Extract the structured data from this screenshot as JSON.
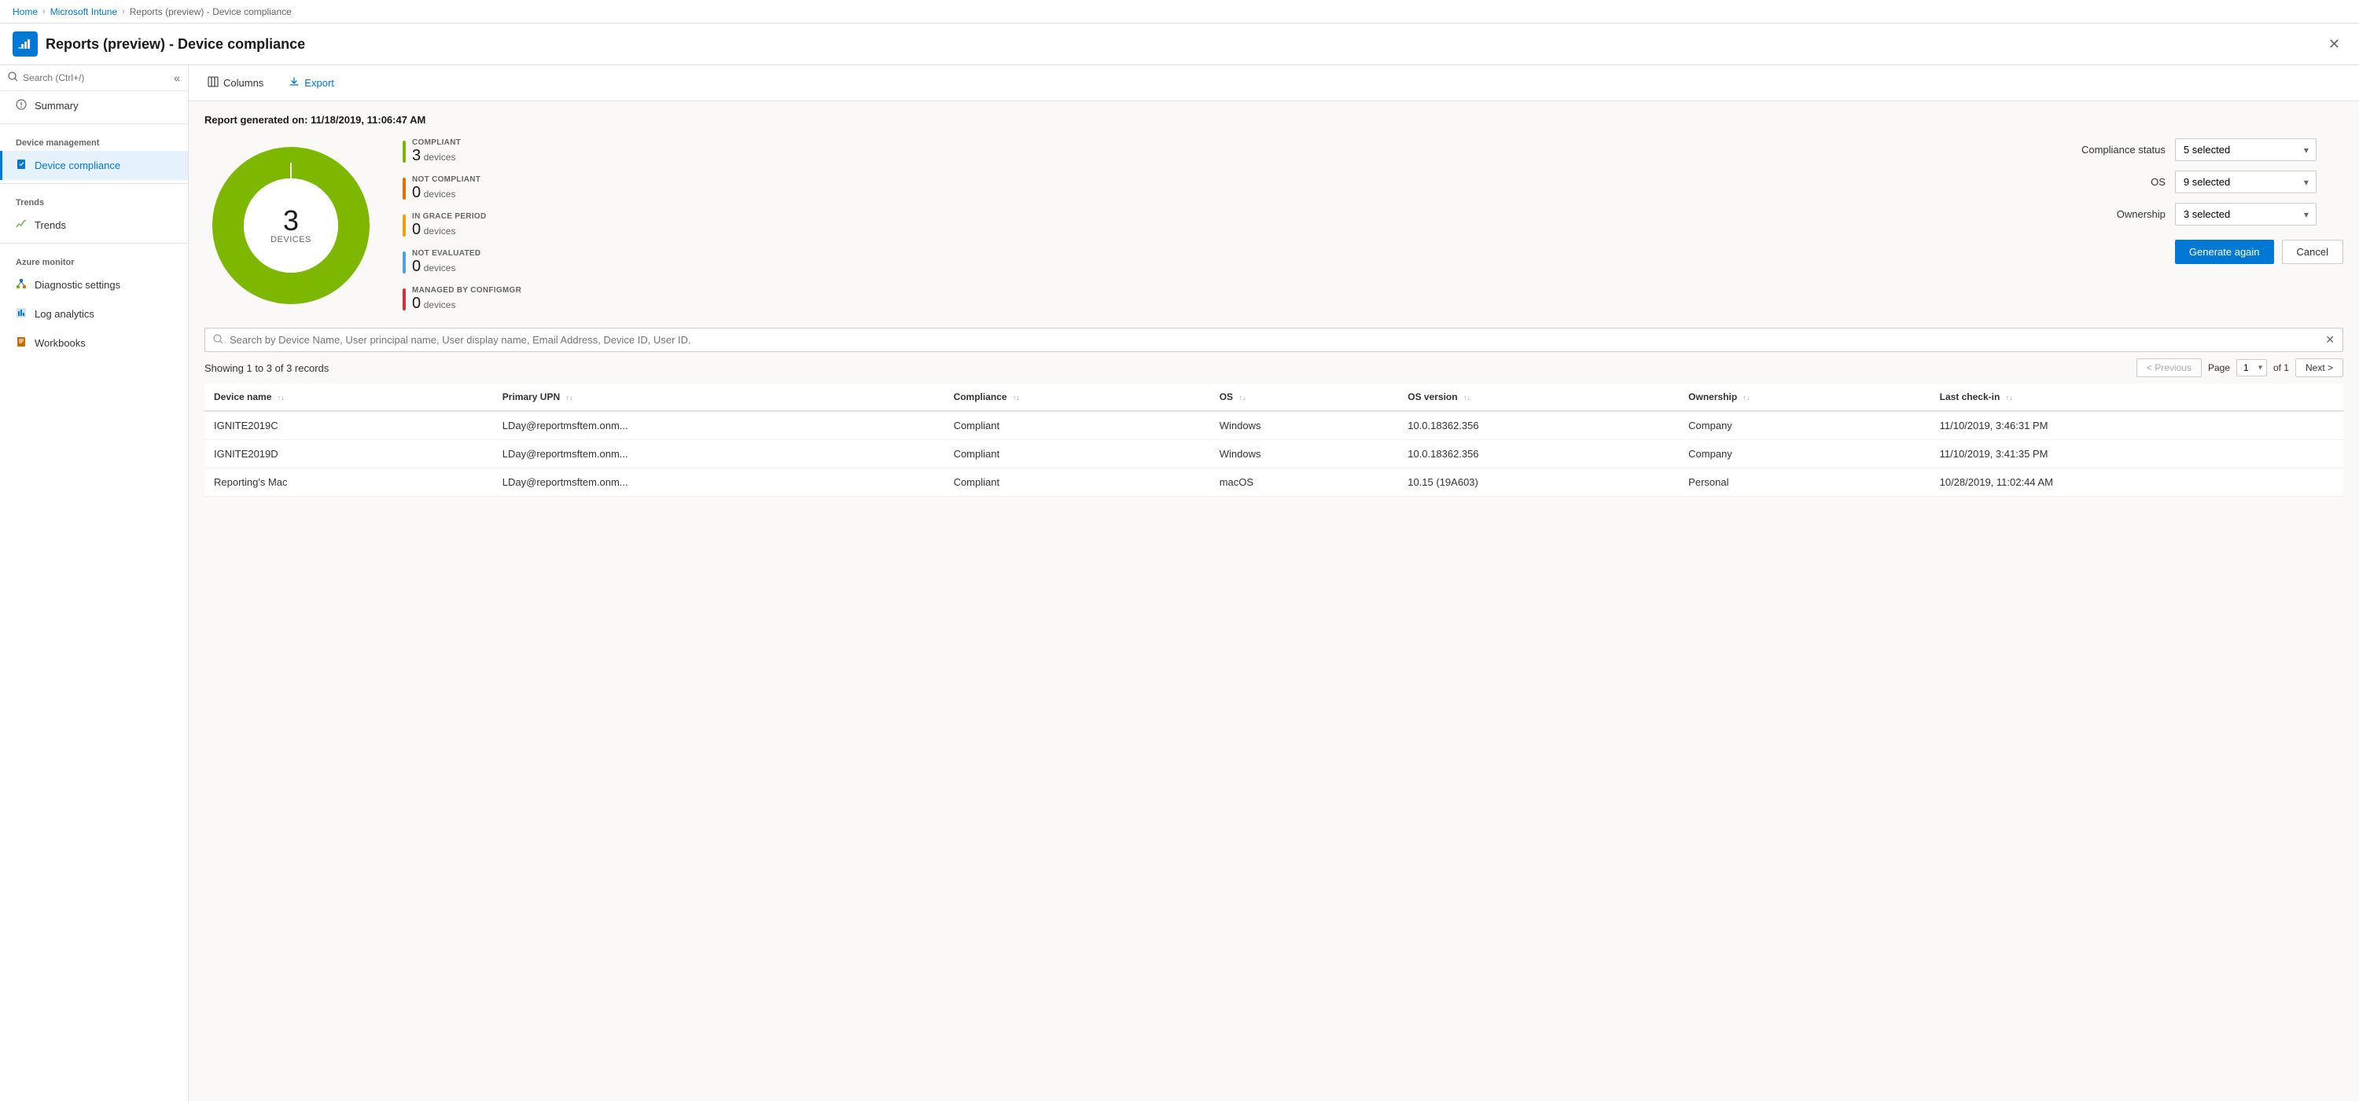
{
  "breadcrumb": {
    "items": [
      "Home",
      "Microsoft Intune",
      "Reports (preview) - Device compliance"
    ],
    "links": [
      "Home",
      "Microsoft Intune"
    ]
  },
  "title": "Reports (preview) - Device compliance",
  "title_icon": "📊",
  "toolbar": {
    "columns_label": "Columns",
    "export_label": "Export"
  },
  "report": {
    "generated_label": "Report generated on: 11/18/2019, 11:06:47 AM"
  },
  "chart": {
    "total": "3",
    "total_label": "DEVICES",
    "segments": [
      {
        "label": "COMPLIANT",
        "count": "3",
        "unit": "devices",
        "color": "#7DB700",
        "percent": 100
      },
      {
        "label": "NOT COMPLIANT",
        "count": "0",
        "unit": "devices",
        "color": "#E07000"
      },
      {
        "label": "IN GRACE PERIOD",
        "count": "0",
        "unit": "devices",
        "color": "#F0A000"
      },
      {
        "label": "NOT EVALUATED",
        "count": "0",
        "unit": "devices",
        "color": "#4CA3DD"
      },
      {
        "label": "MANAGED BY CONFIGMGR",
        "count": "0",
        "unit": "devices",
        "color": "#D13438"
      }
    ]
  },
  "filters": {
    "compliance_status_label": "Compliance status",
    "compliance_status_value": "5 selected",
    "os_label": "OS",
    "os_value": "9 selected",
    "ownership_label": "Ownership",
    "ownership_value": "3 selected",
    "generate_again_label": "Generate again",
    "cancel_label": "Cancel"
  },
  "search": {
    "placeholder": "Search by Device Name, User principal name, User display name, Email Address, Device ID, User ID."
  },
  "table": {
    "records_label": "Showing 1 to 3 of 3 records",
    "columns": [
      {
        "key": "device_name",
        "label": "Device name",
        "sortable": true
      },
      {
        "key": "primary_upn",
        "label": "Primary UPN",
        "sortable": true
      },
      {
        "key": "compliance",
        "label": "Compliance",
        "sortable": true
      },
      {
        "key": "os",
        "label": "OS",
        "sortable": true
      },
      {
        "key": "os_version",
        "label": "OS version",
        "sortable": true
      },
      {
        "key": "ownership",
        "label": "Ownership",
        "sortable": true
      },
      {
        "key": "last_checkin",
        "label": "Last check-in",
        "sortable": true
      }
    ],
    "rows": [
      {
        "device_name": "IGNITE2019C",
        "primary_upn": "LDay@reportmsftem.onm...",
        "compliance": "Compliant",
        "os": "Windows",
        "os_version": "10.0.18362.356",
        "ownership": "Company",
        "last_checkin": "11/10/2019, 3:46:31 PM"
      },
      {
        "device_name": "IGNITE2019D",
        "primary_upn": "LDay@reportmsftem.onm...",
        "compliance": "Compliant",
        "os": "Windows",
        "os_version": "10.0.18362.356",
        "ownership": "Company",
        "last_checkin": "11/10/2019, 3:41:35 PM"
      },
      {
        "device_name": "Reporting's Mac",
        "primary_upn": "LDay@reportmsftem.onm...",
        "compliance": "Compliant",
        "os": "macOS",
        "os_version": "10.15 (19A603)",
        "ownership": "Personal",
        "last_checkin": "10/28/2019, 11:02:44 AM"
      }
    ]
  },
  "pagination": {
    "previous_label": "< Previous",
    "next_label": "Next >",
    "page_label": "Page",
    "of_label": "of 1",
    "current_page": "1"
  },
  "sidebar": {
    "search_placeholder": "Search (Ctrl+/)",
    "collapse_icon": "«",
    "sections": [
      {
        "items": [
          {
            "id": "summary",
            "label": "Summary",
            "icon": "ℹ",
            "active": false
          }
        ]
      },
      {
        "section_label": "Device management",
        "items": [
          {
            "id": "device-compliance",
            "label": "Device compliance",
            "icon": "📋",
            "active": true
          }
        ]
      },
      {
        "section_label": "Trends",
        "items": [
          {
            "id": "trends",
            "label": "Trends",
            "icon": "📈",
            "active": false
          }
        ]
      },
      {
        "section_label": "Azure monitor",
        "items": [
          {
            "id": "diagnostic-settings",
            "label": "Diagnostic settings",
            "icon": "⚙",
            "active": false
          },
          {
            "id": "log-analytics",
            "label": "Log analytics",
            "icon": "📊",
            "active": false
          },
          {
            "id": "workbooks",
            "label": "Workbooks",
            "icon": "📓",
            "active": false
          }
        ]
      }
    ]
  }
}
